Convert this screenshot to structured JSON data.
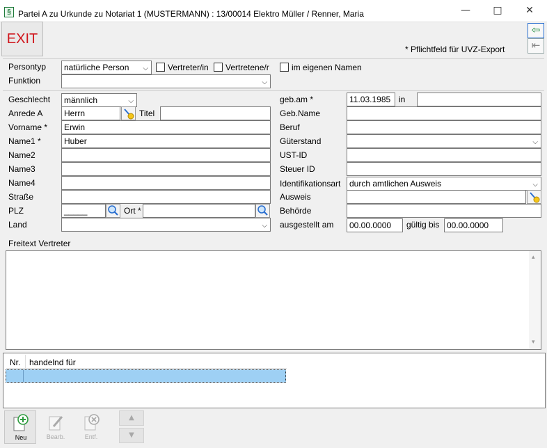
{
  "window": {
    "title": "Partei A zu Urkunde zu Notariat 1 (MUSTERMANN) : 13/00014  Elektro Müller / Renner, Maria",
    "app_icon": "paragraph-icon",
    "icon_glyph": "§"
  },
  "toolbar": {
    "exit_label": "EXIT",
    "hint": "* Pflichtfeld für UVZ-Export"
  },
  "persontyp": {
    "label": "Persontyp",
    "value": "natürliche Person",
    "vertreter_label": "Vertreter/in",
    "vertretene_label": "Vertretene/r",
    "eigenen_label": "im eigenen Namen"
  },
  "funktion": {
    "label": "Funktion",
    "value": ""
  },
  "left": {
    "geschlecht_label": "Geschlecht",
    "geschlecht_value": "männlich",
    "anrede_label": "Anrede A",
    "anrede_value": "Herrn",
    "titel_label": "Titel",
    "titel_value": "",
    "vorname_label": "Vorname *",
    "vorname_value": "Erwin",
    "name1_label": "Name1 *",
    "name1_value": "Huber",
    "name2_label": "Name2",
    "name3_label": "Name3",
    "name4_label": "Name4",
    "strasse_label": "Straße",
    "plz_label": "PLZ",
    "plz_value": "_____",
    "ort_label": "Ort *",
    "ort_value": "",
    "land_label": "Land",
    "land_value": ""
  },
  "right": {
    "gebam_label": "geb.am *",
    "gebam_value": "11.03.1985",
    "in_label": "in",
    "in_value": "",
    "gebname_label": "Geb.Name",
    "beruf_label": "Beruf",
    "gueterstand_label": "Güterstand",
    "ustid_label": "UST-ID",
    "steuerid_label": "Steuer ID",
    "identart_label": "Identifikationsart",
    "identart_value": "durch amtlichen Ausweis",
    "ausweis_label": "Ausweis",
    "behoerde_label": "Behörde",
    "ausgestellt_label": "ausgestellt am",
    "ausgestellt_value": "00.00.0000",
    "gueltig_label": "gültig bis",
    "gueltig_value": "00.00.0000"
  },
  "freitext": {
    "label": "Freitext Vertreter"
  },
  "list": {
    "col_nr": "Nr.",
    "col_handelnd": "handelnd für"
  },
  "bottom": {
    "neu": "Neu",
    "bearb": "Bearb.",
    "entf": "Entf."
  }
}
